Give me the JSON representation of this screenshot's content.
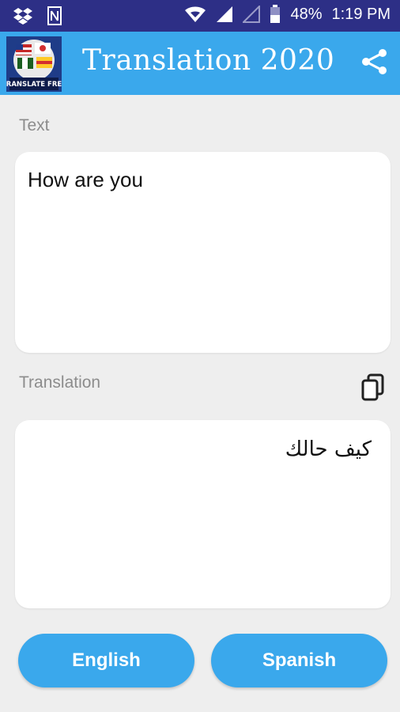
{
  "status_bar": {
    "battery_percent": "48%",
    "time": "1:19 PM",
    "icons": [
      "dropbox-icon",
      "notes-icon",
      "wifi-icon",
      "signal-icon",
      "signal-empty-icon",
      "battery-icon"
    ]
  },
  "app_bar": {
    "title": "Translation 2020",
    "logo_text": "TRANSLATE FREE",
    "share_icon": "share-icon"
  },
  "source": {
    "label": "Text",
    "value": "How are you"
  },
  "translation": {
    "label": "Translation",
    "value": "كيف حالك",
    "copy_icon": "copy-icon"
  },
  "buttons": {
    "source_language": "English",
    "target_language": "Spanish"
  },
  "colors": {
    "status_bar": "#2d2f86",
    "app_bar": "#3aa8ec",
    "button": "#3aa8ec",
    "background": "#eeeeee"
  }
}
